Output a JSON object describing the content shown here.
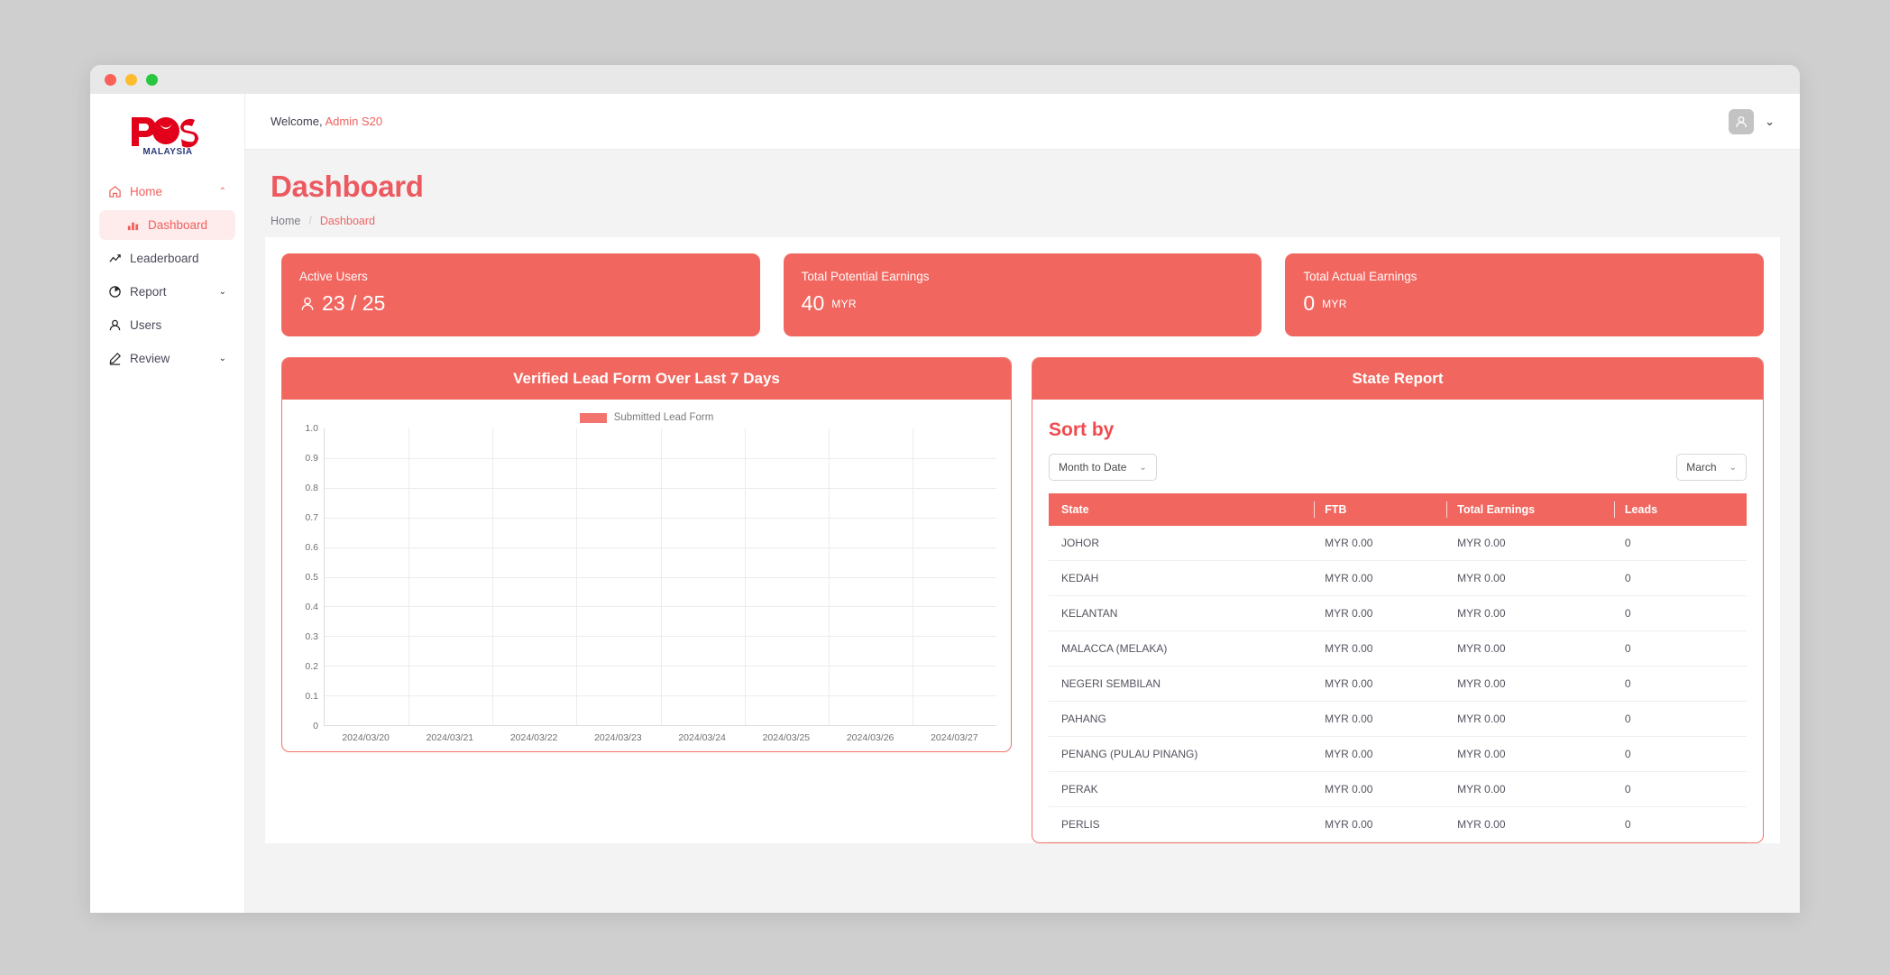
{
  "window": {
    "traffic_lights": [
      "close",
      "minimize",
      "maximize"
    ]
  },
  "sidebar": {
    "logo": {
      "primary": "POS",
      "secondary": "MALAYSIA"
    },
    "items": [
      {
        "label": "Home",
        "icon": "home-icon",
        "chevron": "⌃",
        "state": "accent"
      },
      {
        "label": "Dashboard",
        "icon": "chart-bar-icon",
        "state": "active"
      },
      {
        "label": "Leaderboard",
        "icon": "trend-up-icon",
        "state": "normal"
      },
      {
        "label": "Report",
        "icon": "pie-chart-icon",
        "chevron": "⌄",
        "state": "normal"
      },
      {
        "label": "Users",
        "icon": "user-icon",
        "state": "normal"
      },
      {
        "label": "Review",
        "icon": "pencil-icon",
        "chevron": "⌄",
        "state": "normal"
      }
    ]
  },
  "topbar": {
    "welcome_prefix": "Welcome,",
    "user_name": "Admin S20",
    "avatar_icon": "user-avatar-icon",
    "caret": "⌄"
  },
  "page": {
    "title": "Dashboard",
    "breadcrumb": {
      "home": "Home",
      "separator": "/",
      "current": "Dashboard"
    }
  },
  "cards": [
    {
      "title": "Active Users",
      "value": "23 / 25",
      "unit": "",
      "icon": "user-icon"
    },
    {
      "title": "Total Potential Earnings",
      "value": "40",
      "unit": "MYR",
      "icon": ""
    },
    {
      "title": "Total Actual Earnings",
      "value": "0",
      "unit": "MYR",
      "icon": ""
    }
  ],
  "chart_panel": {
    "title": "Verified Lead Form Over Last 7 Days"
  },
  "chart_data": {
    "type": "bar",
    "title": "Verified Lead Form Over Last 7 Days",
    "categories": [
      "2024/03/20",
      "2024/03/21",
      "2024/03/22",
      "2024/03/23",
      "2024/03/24",
      "2024/03/25",
      "2024/03/26",
      "2024/03/27"
    ],
    "series": [
      {
        "name": "Submitted Lead Form",
        "values": [
          0,
          0,
          0,
          0,
          0,
          0,
          0,
          0
        ],
        "color": "#f3746f"
      }
    ],
    "yticks": [
      "1.0",
      "0.9",
      "0.8",
      "0.7",
      "0.6",
      "0.5",
      "0.4",
      "0.3",
      "0.2",
      "0.1",
      "0"
    ],
    "ylim": [
      0,
      1
    ],
    "xlabel": "",
    "ylabel": "",
    "grid": true,
    "legend_position": "top-center"
  },
  "report_panel": {
    "title": "State Report",
    "sort_by_label": "Sort by",
    "range_select": {
      "value": "Month to Date",
      "chevron": "⌄"
    },
    "month_select": {
      "value": "March",
      "chevron": "⌄"
    },
    "columns": [
      "State",
      "FTB",
      "Total Earnings",
      "Leads"
    ],
    "rows": [
      {
        "state": "JOHOR",
        "ftb": "MYR 0.00",
        "earnings": "MYR 0.00",
        "leads": "0"
      },
      {
        "state": "KEDAH",
        "ftb": "MYR 0.00",
        "earnings": "MYR 0.00",
        "leads": "0"
      },
      {
        "state": "KELANTAN",
        "ftb": "MYR 0.00",
        "earnings": "MYR 0.00",
        "leads": "0"
      },
      {
        "state": "MALACCA (MELAKA)",
        "ftb": "MYR 0.00",
        "earnings": "MYR 0.00",
        "leads": "0"
      },
      {
        "state": "NEGERI SEMBILAN",
        "ftb": "MYR 0.00",
        "earnings": "MYR 0.00",
        "leads": "0"
      },
      {
        "state": "PAHANG",
        "ftb": "MYR 0.00",
        "earnings": "MYR 0.00",
        "leads": "0"
      },
      {
        "state": "PENANG (PULAU PINANG)",
        "ftb": "MYR 0.00",
        "earnings": "MYR 0.00",
        "leads": "0"
      },
      {
        "state": "PERAK",
        "ftb": "MYR 0.00",
        "earnings": "MYR 0.00",
        "leads": "0"
      },
      {
        "state": "PERLIS",
        "ftb": "MYR 0.00",
        "earnings": "MYR 0.00",
        "leads": "0"
      }
    ]
  },
  "colors": {
    "accent": "#f1675f",
    "accent_text": "#ec5a60",
    "sort_by": "#f04a4f",
    "logo_red": "#e2001a",
    "logo_navy": "#2b3a7a",
    "desktop": "#cfcfcf"
  }
}
